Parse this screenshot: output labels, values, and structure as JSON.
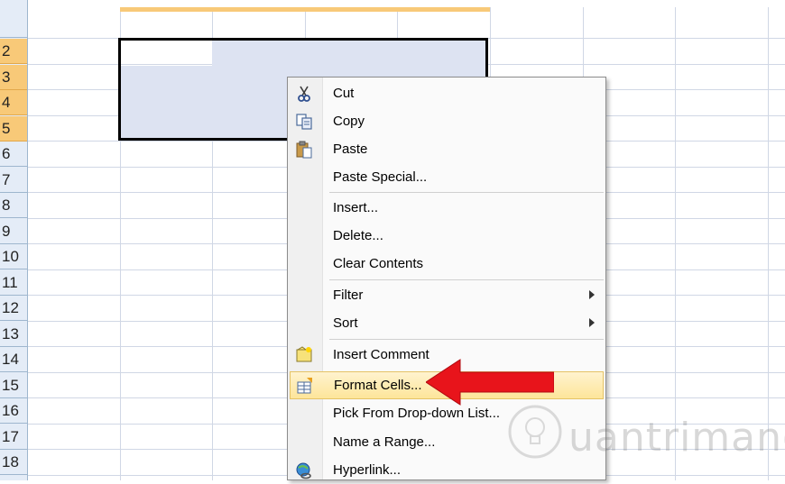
{
  "sheet": {
    "row_numbers": [
      "2",
      "3",
      "4",
      "5",
      "6",
      "7",
      "8",
      "9",
      "10",
      "11",
      "12",
      "13",
      "14",
      "15",
      "16",
      "17",
      "18"
    ]
  },
  "menu": {
    "items": [
      {
        "label": "Cut",
        "icon": "scissors-icon"
      },
      {
        "label": "Copy",
        "icon": "copy-icon"
      },
      {
        "label": "Paste",
        "icon": "paste-icon"
      },
      {
        "label": "Paste Special...",
        "icon": ""
      },
      {
        "label": "Insert...",
        "icon": ""
      },
      {
        "label": "Delete...",
        "icon": ""
      },
      {
        "label": "Clear Contents",
        "icon": ""
      },
      {
        "label": "Filter",
        "icon": "",
        "submenu": true
      },
      {
        "label": "Sort",
        "icon": "",
        "submenu": true
      },
      {
        "label": "Insert Comment",
        "icon": "comment-icon"
      },
      {
        "label": "Format Cells...",
        "icon": "format-cells-icon",
        "highlighted": true
      },
      {
        "label": "Pick From Drop-down List...",
        "icon": ""
      },
      {
        "label": "Name a Range...",
        "icon": ""
      },
      {
        "label": "Hyperlink...",
        "icon": "hyperlink-icon"
      }
    ]
  },
  "colors": {
    "arrow": "#e8141b",
    "selection_border": "#000000",
    "selected_header": "#f8c978"
  },
  "watermark": {
    "text": "uantrimang"
  }
}
